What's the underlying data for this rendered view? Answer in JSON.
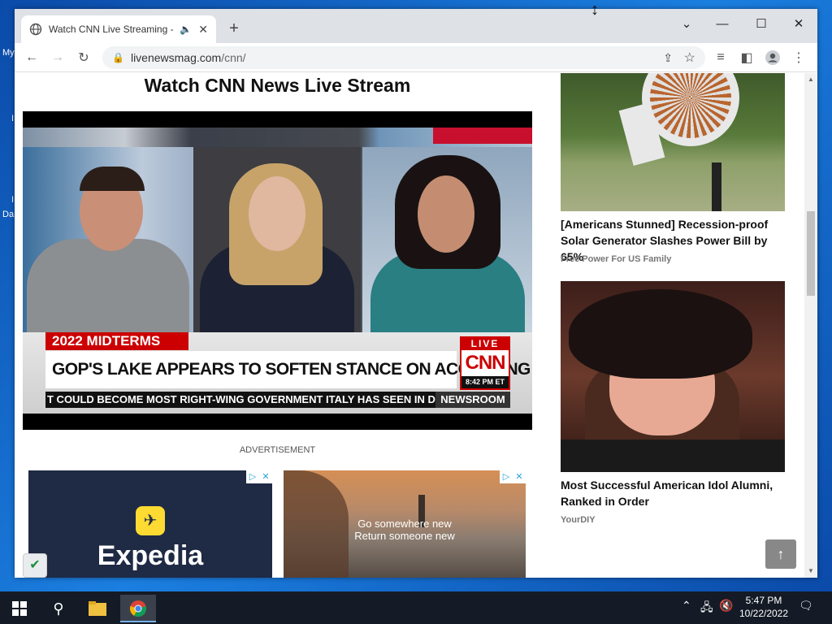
{
  "desktop": {
    "icon_label_1": "My",
    "icon_label_2": "Da",
    "icon_label_3": "I",
    "icon_label_4": "I"
  },
  "browser": {
    "tab_title": "Watch CNN Live Streaming -",
    "address": {
      "domain": "livenewsmag.com",
      "path": "/cnn/"
    }
  },
  "page": {
    "title": "Watch CNN News Live Stream",
    "video": {
      "midterms_label": "2022 MIDTERMS",
      "headline": "GOP'S LAKE APPEARS TO SOFTEN STANCE ON ACCEPTING ELECTION RESULTS",
      "live_label": "LIVE",
      "network_logo": "CNN",
      "time": "8:42 PM ET",
      "ticker": "T COULD BECOME MOST RIGHT-WING GOVERNMENT ITALY HAS SEEN IN DEC",
      "program": "NEWSROOM"
    },
    "advertisement_label": "ADVERTISEMENT",
    "ads": [
      {
        "brand": "Expedia"
      },
      {
        "line1": "Go somewhere new",
        "line2": "Return someone new"
      }
    ],
    "sidebar": [
      {
        "title": "[Americans Stunned] Recession-proof Solar Generator Slashes Power Bill by 65%",
        "source": "Free Power For US Family"
      },
      {
        "title": "Most Successful American Idol Alumni, Ranked in Order",
        "source": "YourDIY"
      }
    ]
  },
  "taskbar": {
    "time": "5:47 PM",
    "date": "10/22/2022"
  },
  "colors": {
    "cnn_red": "#cc0000",
    "taskbar": "#141b26",
    "chrome_frame": "#dee1e6"
  },
  "icons": [
    "windows-start-icon",
    "search-icon",
    "file-explorer-icon",
    "chrome-icon",
    "speaker-icon",
    "network-icon",
    "notification-icon"
  ]
}
